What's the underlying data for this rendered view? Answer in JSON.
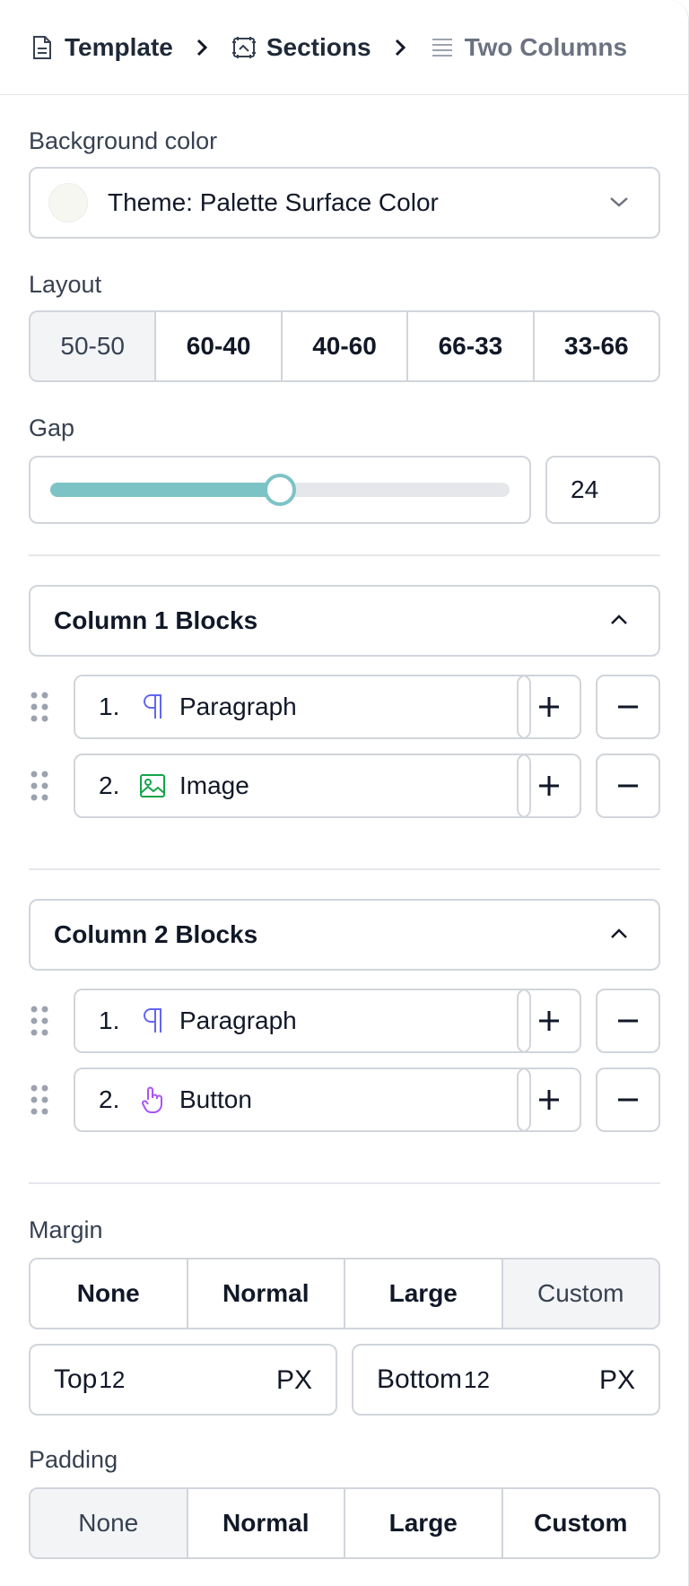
{
  "breadcrumb": {
    "items": [
      {
        "label": "Template",
        "icon": "file-icon"
      },
      {
        "label": "Sections",
        "icon": "frame-icon"
      },
      {
        "label": "Two Columns",
        "icon": "lines-icon"
      }
    ]
  },
  "background": {
    "label": "Background color",
    "value": "Theme: Palette Surface Color",
    "swatch_color": "#f7f7f2"
  },
  "layout": {
    "label": "Layout",
    "options": [
      "50-50",
      "60-40",
      "40-60",
      "66-33",
      "33-66"
    ],
    "selected": "50-50"
  },
  "gap": {
    "label": "Gap",
    "value": "24",
    "slider_fraction": 0.5,
    "accent_color": "#7cc3c6"
  },
  "column1": {
    "title": "Column 1 Blocks",
    "blocks": [
      {
        "index": "1.",
        "label": "Paragraph",
        "icon": "paragraph-icon"
      },
      {
        "index": "2.",
        "label": "Image",
        "icon": "image-icon"
      }
    ]
  },
  "column2": {
    "title": "Column 2 Blocks",
    "blocks": [
      {
        "index": "1.",
        "label": "Paragraph",
        "icon": "paragraph-icon"
      },
      {
        "index": "2.",
        "label": "Button",
        "icon": "pointer-icon"
      }
    ]
  },
  "margin": {
    "label": "Margin",
    "options": [
      "None",
      "Normal",
      "Large",
      "Custom"
    ],
    "selected": "Custom",
    "top": {
      "label": "Top",
      "value": "12",
      "unit": "PX"
    },
    "bottom": {
      "label": "Bottom",
      "value": "12",
      "unit": "PX"
    }
  },
  "padding": {
    "label": "Padding",
    "options": [
      "None",
      "Normal",
      "Large",
      "Custom"
    ],
    "selected": "None"
  },
  "colors": {
    "paragraph_icon": "#6366f1",
    "image_icon": "#16a34a",
    "button_icon": "#a855f7"
  }
}
